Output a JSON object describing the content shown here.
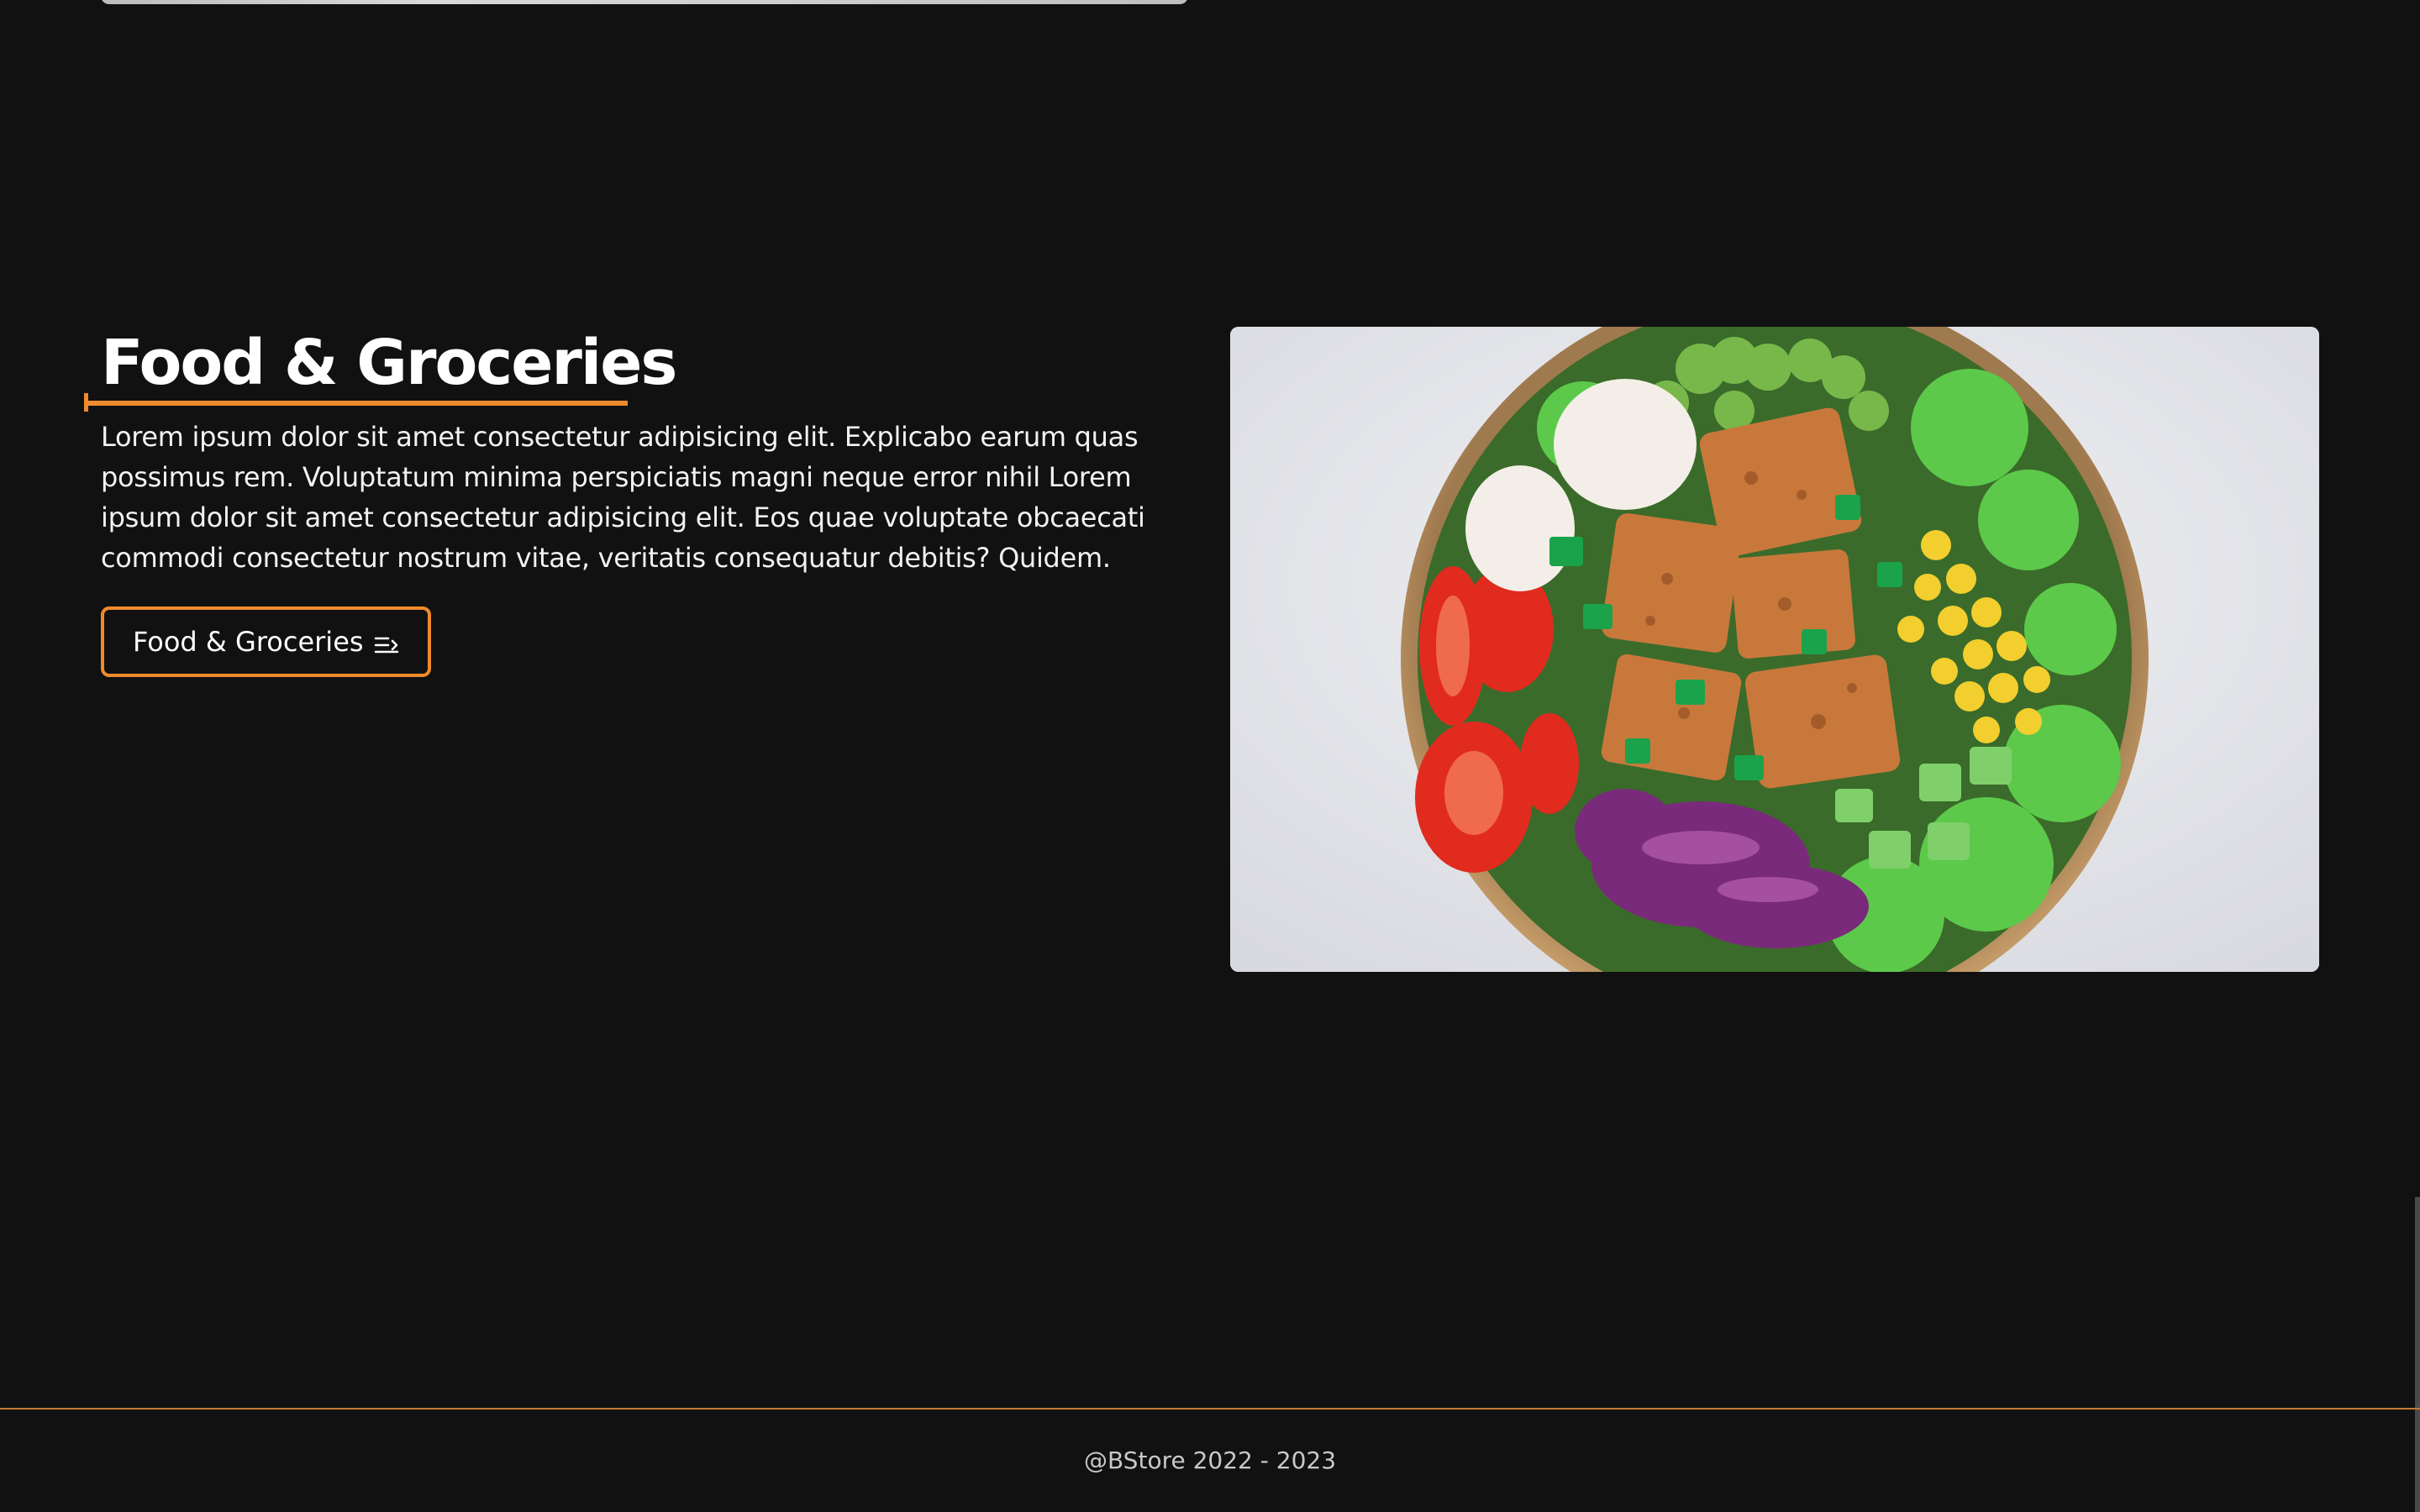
{
  "section": {
    "title": "Food & Groceries",
    "description": "Lorem ipsum dolor sit amet consectetur adipisicing elit. Explicabo earum quas possimus rem. Voluptatum minima perspiciatis magni neque error nihil Lorem ipsum dolor sit amet consectetur adipisicing elit. Eos quae voluptate obcaecati commodi consectetur nostrum vitae, veritatis consequatur debitis? Quidem.",
    "button_label": "Food & Groceries",
    "button_icon": "menu-arrow-icon",
    "image_subject": "salad-bowl-image"
  },
  "footer": {
    "copyright": "@BStore 2022 - 2023"
  },
  "colors": {
    "background": "#111111",
    "accent": "#f08a2c",
    "text": "#ffffff",
    "footer_text": "#c9c9c9"
  }
}
